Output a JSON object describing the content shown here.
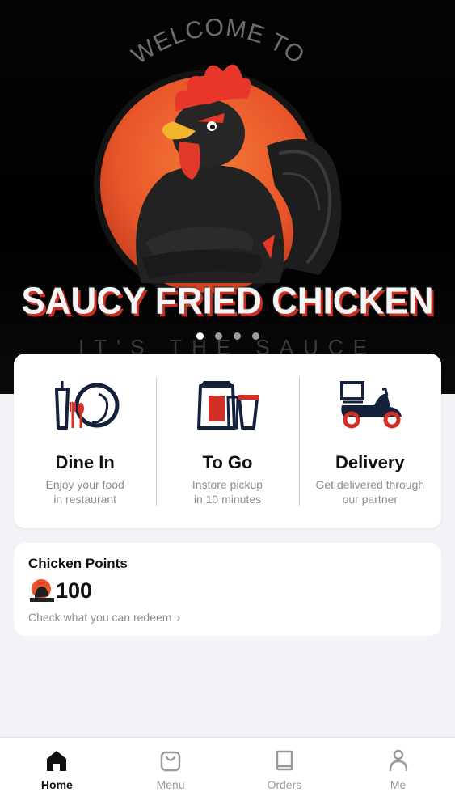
{
  "hero": {
    "welcome": "WELCOME TO",
    "brand": "SAUCY FRIED CHICKEN",
    "tagline": "IT'S THE SAUCE",
    "carousel": {
      "count": 4,
      "active_index": 0
    }
  },
  "order_options": [
    {
      "title": "Dine In",
      "desc_line1": "Enjoy your food",
      "desc_line2": "in restaurant",
      "icon": "dine-in-icon"
    },
    {
      "title": "To Go",
      "desc_line1": "Instore pickup",
      "desc_line2": "in 10 minutes",
      "icon": "to-go-icon"
    },
    {
      "title": "Delivery",
      "desc_line1": "Get delivered through",
      "desc_line2": "our partner",
      "icon": "delivery-scooter-icon"
    }
  ],
  "points": {
    "title": "Chicken Points",
    "value": "100",
    "link": "Check what you can redeem"
  },
  "tabbar": {
    "tabs": [
      {
        "label": "Home",
        "icon": "home-icon",
        "active": true
      },
      {
        "label": "Menu",
        "icon": "bag-icon",
        "active": false
      },
      {
        "label": "Orders",
        "icon": "book-icon",
        "active": false
      },
      {
        "label": "Me",
        "icon": "person-icon",
        "active": false
      }
    ]
  },
  "colors": {
    "accent_red": "#c62f22",
    "navy": "#14213d",
    "orange_circle": "#e8552a"
  }
}
